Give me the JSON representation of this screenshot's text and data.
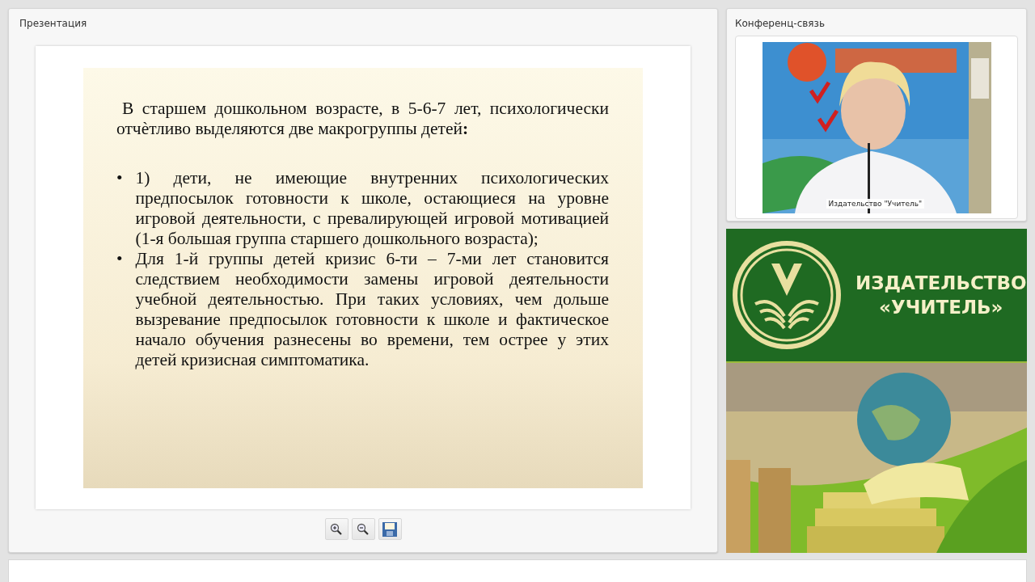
{
  "presentation": {
    "title": "Презентация",
    "slide": {
      "intro": "В старшем дошкольном возрасте, в 5-6-7 лет, психологически отчѐтливо выделяются две макрогруппы детей**:**",
      "bullet_marker": "•",
      "bullets": [
        "1) дети, не имеющие внутренних психологических предпосылок готовности к школе, остающиеся на уровне игровой деятельности, с превалирующей игровой мотивацией (1-я большая группа старшего дошкольного возраста);",
        "Для 1-й группы детей кризис 6-ти – 7-ми лет становится следствием необходимости замены игровой деятельности учебной деятельностью. При таких условиях, чем дольше вызревание предпосылок готовности к школе и фактическое начало обучения разнесены во времени, тем острее у этих детей кризисная симптоматика."
      ]
    },
    "tools": [
      {
        "kind": "zoom-in"
      },
      {
        "kind": "zoom-out"
      },
      {
        "kind": "save"
      }
    ]
  },
  "conference": {
    "title": "Конференц-связь",
    "video": {
      "kind": "picture",
      "caption": "Издательство \"Учитель\""
    }
  },
  "banner": {
    "title_lines": [
      "ИЗДАТЕЛЬСТВО",
      "«УЧИТЕЛЬ»"
    ],
    "photo": {
      "kind": "picture"
    }
  }
}
